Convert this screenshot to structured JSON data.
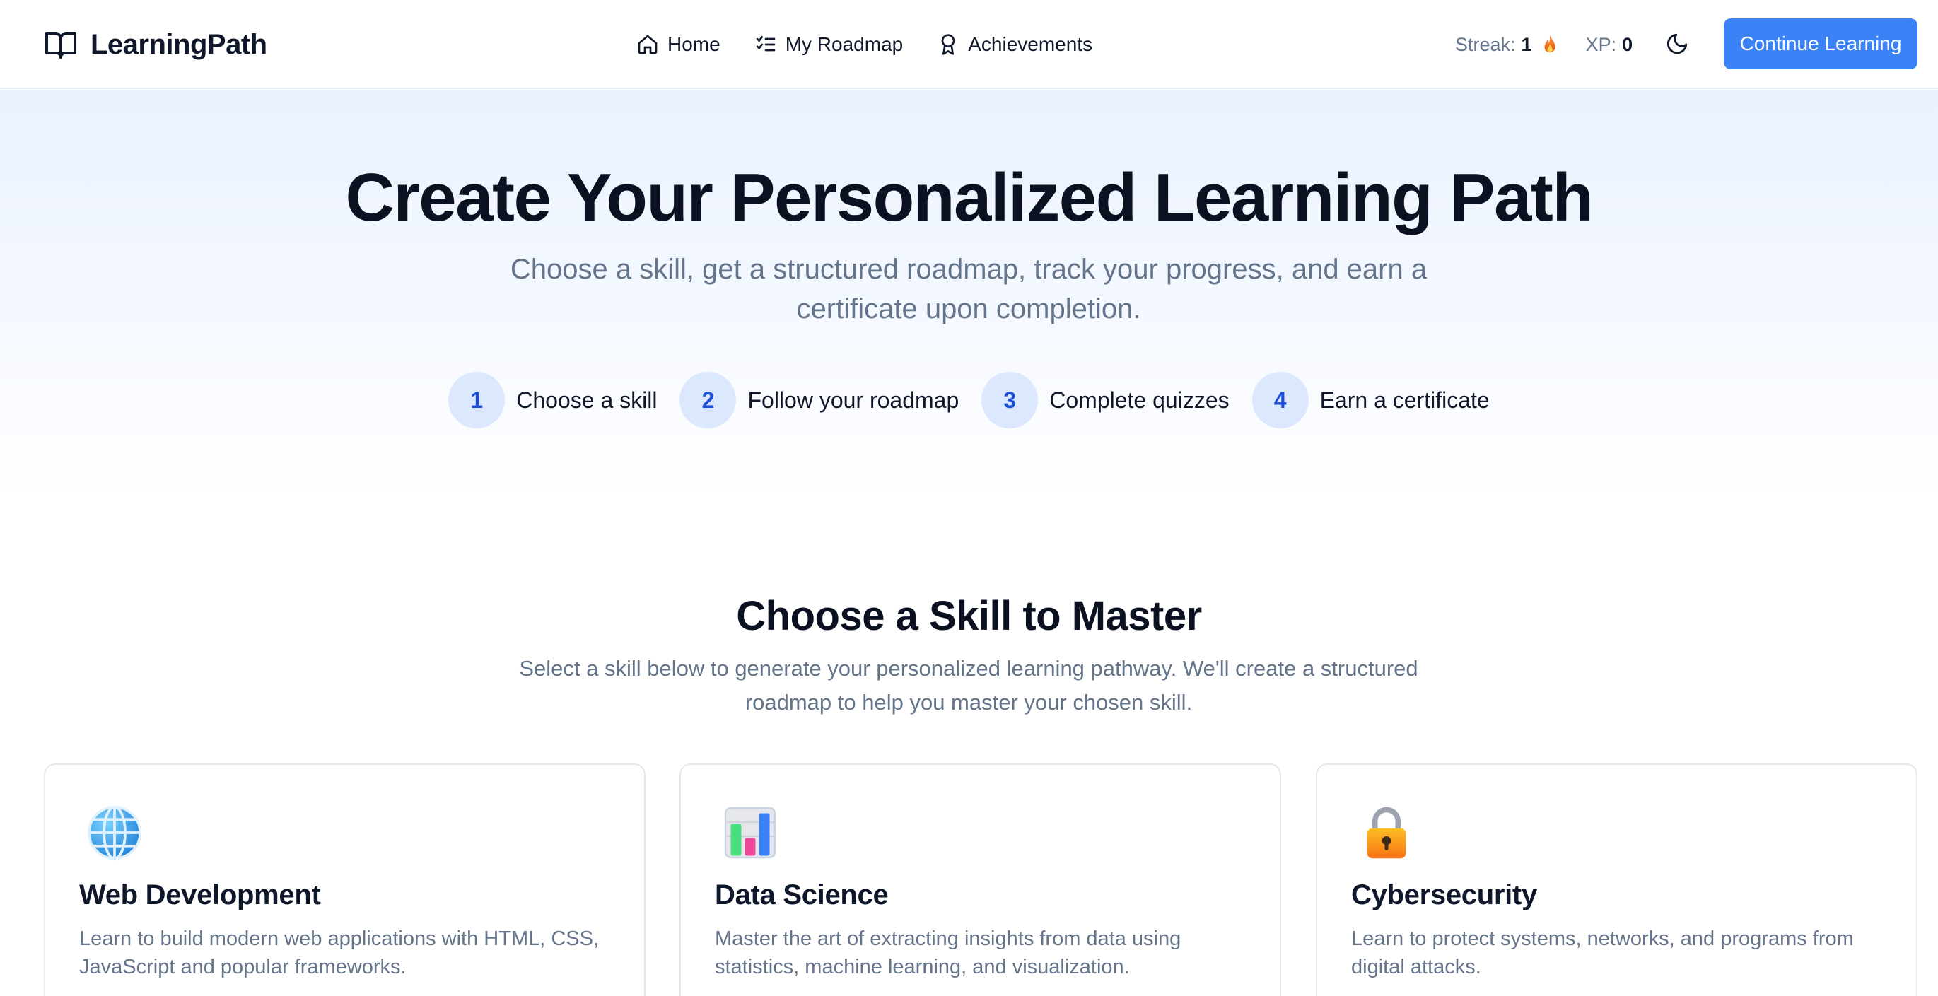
{
  "brand": {
    "name": "LearningPath",
    "icon": "open-book-icon"
  },
  "nav": [
    {
      "label": "Home",
      "icon": "home-icon"
    },
    {
      "label": "My Roadmap",
      "icon": "checklist-icon"
    },
    {
      "label": "Achievements",
      "icon": "award-ribbon-icon"
    }
  ],
  "stats": {
    "streak_label": "Streak:",
    "streak_value": "1",
    "streak_icon": "fire-icon",
    "xp_label": "XP:",
    "xp_value": "0"
  },
  "theme_toggle": {
    "icon": "moon-icon"
  },
  "cta": {
    "label": "Continue Learning"
  },
  "hero": {
    "title": "Create Your Personalized Learning Path",
    "subtitle": "Choose a skill, get a structured roadmap, track your progress, and earn a certificate upon completion.",
    "steps": [
      {
        "number": "1",
        "label": "Choose a skill"
      },
      {
        "number": "2",
        "label": "Follow your roadmap"
      },
      {
        "number": "3",
        "label": "Complete quizzes"
      },
      {
        "number": "4",
        "label": "Earn a certificate"
      }
    ]
  },
  "skills_section": {
    "title": "Choose a Skill to Master",
    "subtitle": "Select a skill below to generate your personalized learning pathway. We'll create a structured roadmap to help you master your chosen skill.",
    "cards": [
      {
        "title": "Web Development",
        "icon": "globe-icon",
        "description": "Learn to build modern web applications with HTML, CSS, JavaScript and popular frameworks."
      },
      {
        "title": "Data Science",
        "icon": "bar-chart-icon",
        "description": "Master the art of extracting insights from data using statistics, machine learning, and visualization."
      },
      {
        "title": "Cybersecurity",
        "icon": "padlock-icon",
        "description": "Learn to protect systems, networks, and programs from digital attacks."
      }
    ]
  },
  "colors": {
    "accent": "#3b82f6",
    "step_circle_bg": "#dbe8fd",
    "step_circle_text": "#1d4ed8",
    "muted_text": "#64748b",
    "heading_text": "#0b1120"
  }
}
